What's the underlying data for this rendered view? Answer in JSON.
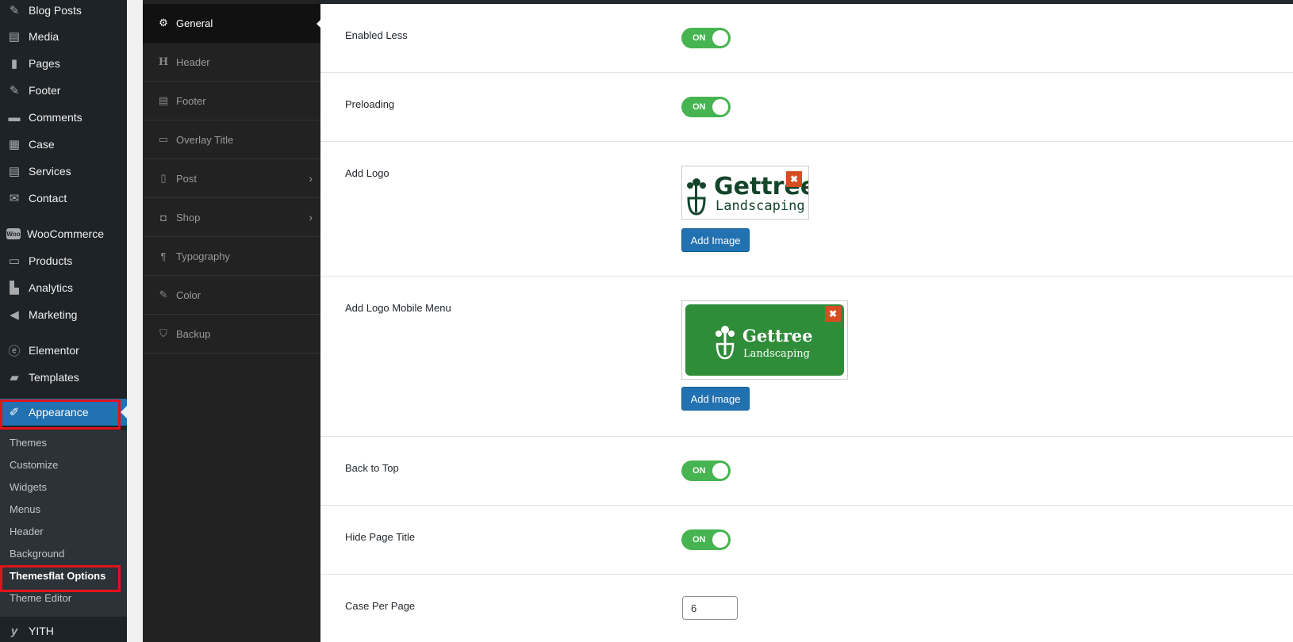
{
  "admin_menu": {
    "items": [
      {
        "label": "Blog Posts",
        "icon": "pin-icon"
      },
      {
        "label": "Media",
        "icon": "media-icon"
      },
      {
        "label": "Pages",
        "icon": "pages-icon"
      },
      {
        "label": "Footer",
        "icon": "pin-icon"
      },
      {
        "label": "Comments",
        "icon": "comments-icon"
      },
      {
        "label": "Case",
        "icon": "calendar-icon"
      },
      {
        "label": "Services",
        "icon": "services-icon"
      },
      {
        "label": "Contact",
        "icon": "mail-icon"
      },
      {
        "label": "WooCommerce",
        "icon": "woo-icon"
      },
      {
        "label": "Products",
        "icon": "archive-icon"
      },
      {
        "label": "Analytics",
        "icon": "chart-icon"
      },
      {
        "label": "Marketing",
        "icon": "megaphone-icon"
      },
      {
        "label": "Elementor",
        "icon": "elementor-icon"
      },
      {
        "label": "Templates",
        "icon": "folder-icon"
      },
      {
        "label": "Appearance",
        "icon": "paintbrush-icon",
        "active": true
      },
      {
        "label": "YITH",
        "icon": "yith-icon"
      }
    ],
    "submenu": [
      "Themes",
      "Customize",
      "Widgets",
      "Menus",
      "Header",
      "Background",
      "Themesflat Options",
      "Theme Editor"
    ],
    "current_submenu": "Themesflat Options"
  },
  "options_nav": {
    "items": [
      {
        "label": "General",
        "icon": "gears-icon",
        "active": true
      },
      {
        "label": "Header",
        "icon": "header-icon"
      },
      {
        "label": "Footer",
        "icon": "footer-icon"
      },
      {
        "label": "Overlay Title",
        "icon": "window-icon"
      },
      {
        "label": "Post",
        "icon": "post-icon",
        "has_children": true
      },
      {
        "label": "Shop",
        "icon": "bag-icon",
        "has_children": true
      },
      {
        "label": "Typography",
        "icon": "paragraph-icon"
      },
      {
        "label": "Color",
        "icon": "brush-icon"
      },
      {
        "label": "Backup",
        "icon": "shield-icon"
      }
    ]
  },
  "settings": {
    "enabled_less": {
      "label": "Enabled Less",
      "state": "ON"
    },
    "preloading": {
      "label": "Preloading",
      "state": "ON"
    },
    "add_logo": {
      "label": "Add Logo",
      "button": "Add Image",
      "remove": "✖",
      "logo_text": "Gettree",
      "logo_sub": "Landscaping"
    },
    "add_logo_mobile": {
      "label": "Add Logo Mobile Menu",
      "button": "Add Image",
      "remove": "✖",
      "logo_text": "Gettree",
      "logo_sub": "Landscaping"
    },
    "back_to_top": {
      "label": "Back to Top",
      "state": "ON"
    },
    "hide_page_title": {
      "label": "Hide Page Title",
      "state": "ON"
    },
    "case_per_page": {
      "label": "Case Per Page",
      "value": "6"
    }
  },
  "colors": {
    "toggle_on": "#46b450",
    "wp_blue": "#2271b1",
    "logo_dark": "#14452b",
    "logo_green": "#2f8d3a",
    "highlight": "#e0141b"
  }
}
